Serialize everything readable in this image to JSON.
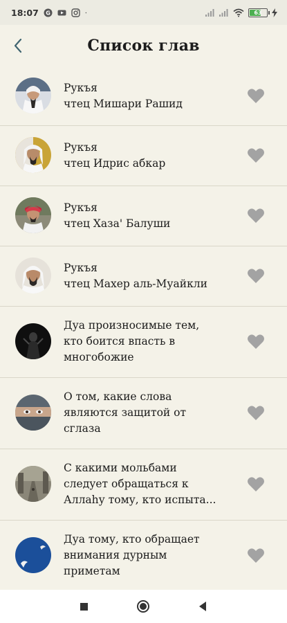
{
  "status_bar": {
    "time": "18:07",
    "icons": [
      "g-icon",
      "youtube-icon",
      "instagram-icon",
      "dot-icon"
    ],
    "battery_percent": "63",
    "battery_color": "#4caf50"
  },
  "header": {
    "title": "Список глав",
    "back_icon": "chevron-left-icon"
  },
  "chapters": [
    {
      "line1": "Рукъя",
      "line2": "чтец Мишари Рашид",
      "avatar": "reciter-1"
    },
    {
      "line1": "Рукъя",
      "line2": "чтец Идрис абкар",
      "avatar": "reciter-2"
    },
    {
      "line1": "Рукъя",
      "line2": "чтец Хаза' Балуши",
      "avatar": "reciter-3"
    },
    {
      "line1": "Рукъя",
      "line2": "чтец Махер аль-Муайкли",
      "avatar": "reciter-4"
    },
    {
      "line1": "Дуа произносимые тем,",
      "line2": "кто боится впасть в",
      "line3": "многобожие",
      "avatar": "dark-figure"
    },
    {
      "line1": "О том, какие слова",
      "line2": "являются защитой от",
      "line3": "сглаза",
      "avatar": "veiled-eyes"
    },
    {
      "line1": "С какими мольбами",
      "line2": "следует обращаться к",
      "line3": "Аллаhу тому, кто испыта...",
      "avatar": "street"
    },
    {
      "line1": "Дуа тому, кто обращает",
      "line2": "внимания дурным",
      "line3": "приметам",
      "avatar": "blue-birds"
    }
  ],
  "colors": {
    "background": "#f4f2e8",
    "heart": "#a3a3a3",
    "divider": "#d9d6c8"
  },
  "nav_bar": {
    "icons": [
      "square-icon",
      "home-circle-icon",
      "back-triangle-icon"
    ]
  }
}
